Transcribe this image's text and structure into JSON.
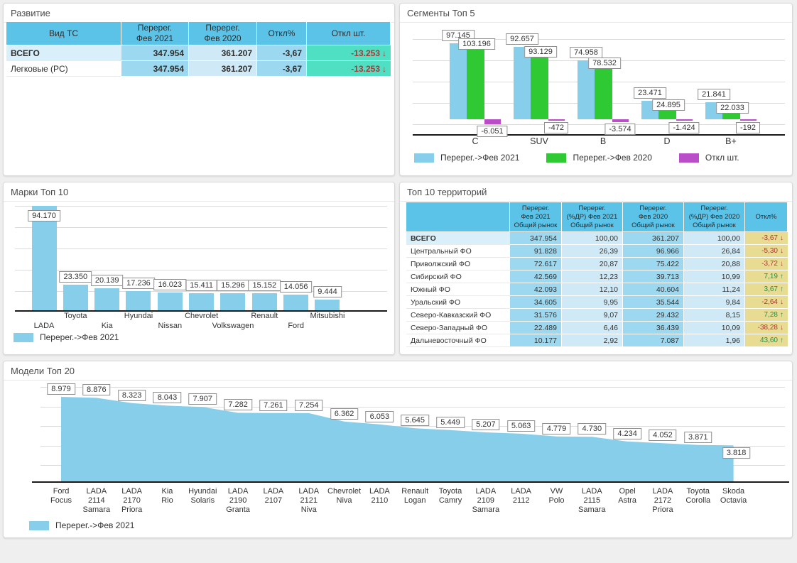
{
  "colors": {
    "background": "#EFEFEF",
    "series_blue": "#87CEEA",
    "series_green": "#2EC933",
    "series_purple": "#BA4EC9",
    "header_cyan": "#5CC3E8",
    "cell_medium_blue": "#9CD8EF",
    "cell_light_blue": "#CFEAF6",
    "cell_teal": "#4FE0C4",
    "cell_yellow": "#E8DC92",
    "row_highlight_blue": "#D9EFF9",
    "negative_text": "#B03535",
    "positive_text": "#1F8F4C"
  },
  "panels": {
    "razvitie": {
      "title": "Развитие",
      "table": {
        "headers": [
          "Вид ТС",
          "Перерег.\nФев 2021",
          "Перерег.\nФев 2020",
          "Откл%",
          "Откл шт."
        ],
        "rows": [
          {
            "label": "ВСЕГО",
            "bold": true,
            "feb2021": "347.954",
            "feb2020": "361.207",
            "otkl_pct": "-3,67",
            "otkl_sht": "-13.253",
            "trend": "down"
          },
          {
            "label": "Легковые (PC)",
            "bold": false,
            "feb2021": "347.954",
            "feb2020": "361.207",
            "otkl_pct": "-3,67",
            "otkl_sht": "-13.253",
            "trend": "down"
          }
        ]
      }
    },
    "segmenty": {
      "title": "Сегменты Топ 5"
    },
    "marki": {
      "title": "Марки Топ 10"
    },
    "territorii": {
      "title": "Топ 10 территорий",
      "table": {
        "headers": [
          "",
          "Перерег.\nФев 2021\nОбщий рынок",
          "Перерег.\n(%ДР) Фев 2021\nОбщий рынок",
          "Перерег.\nФев 2020\nОбщий рынок",
          "Перерег.\n(%ДР) Фев 2020\nОбщий рынок",
          "Откл%"
        ],
        "rows": [
          {
            "label": "ВСЕГО",
            "bold": true,
            "values": [
              "347.954",
              "100,00",
              "361.207",
              "100,00"
            ],
            "otkl": "-3,67",
            "trend": "down"
          },
          {
            "label": "Центральный ФО",
            "bold": false,
            "values": [
              "91.828",
              "26,39",
              "96.966",
              "26,84"
            ],
            "otkl": "-5,30",
            "trend": "down"
          },
          {
            "label": "Приволжский ФО",
            "bold": false,
            "values": [
              "72.617",
              "20,87",
              "75.422",
              "20,88"
            ],
            "otkl": "-3,72",
            "trend": "down"
          },
          {
            "label": "Сибирский ФО",
            "bold": false,
            "values": [
              "42.569",
              "12,23",
              "39.713",
              "10,99"
            ],
            "otkl": "7,19",
            "trend": "up"
          },
          {
            "label": "Южный ФО",
            "bold": false,
            "values": [
              "42.093",
              "12,10",
              "40.604",
              "11,24"
            ],
            "otkl": "3,67",
            "trend": "up"
          },
          {
            "label": "Уральский ФО",
            "bold": false,
            "values": [
              "34.605",
              "9,95",
              "35.544",
              "9,84"
            ],
            "otkl": "-2,64",
            "trend": "down"
          },
          {
            "label": "Северо-Кавказский ФО",
            "bold": false,
            "values": [
              "31.576",
              "9,07",
              "29.432",
              "8,15"
            ],
            "otkl": "7,28",
            "trend": "up"
          },
          {
            "label": "Северо-Западный ФО",
            "bold": false,
            "values": [
              "22.489",
              "6,46",
              "36.439",
              "10,09"
            ],
            "otkl": "-38,28",
            "trend": "down"
          },
          {
            "label": "Дальневосточный ФО",
            "bold": false,
            "values": [
              "10.177",
              "2,92",
              "7.087",
              "1,96"
            ],
            "otkl": "43,60",
            "trend": "up"
          }
        ]
      }
    },
    "modeli": {
      "title": "Модели Топ 20"
    }
  },
  "chart_data": [
    {
      "type": "bar",
      "title": "Сегменты Топ 5",
      "categories": [
        "C",
        "SUV",
        "B",
        "D",
        "B+"
      ],
      "series": [
        {
          "name": "Перерег.->Фев 2021",
          "color": "#87CEEA",
          "values": [
            97145,
            92657,
            74958,
            23471,
            21841
          ]
        },
        {
          "name": "Перерег.->Фев 2020",
          "color": "#2EC933",
          "values": [
            103196,
            93129,
            78532,
            24895,
            22033
          ]
        },
        {
          "name": "Откл шт.",
          "color": "#BA4EC9",
          "values": [
            -6051,
            -472,
            -3574,
            -1424,
            -192
          ]
        }
      ],
      "grid": true,
      "legend_position": "bottom"
    },
    {
      "type": "bar",
      "title": "Марки Топ 10",
      "categories": [
        "LADA",
        "Toyota",
        "Kia",
        "Hyundai",
        "Nissan",
        "Chevrolet",
        "Volkswagen",
        "Renault",
        "Ford",
        "Mitsubishi"
      ],
      "series": [
        {
          "name": "Перерег.->Фев 2021",
          "color": "#87CEEA",
          "values": [
            94170,
            23350,
            20139,
            17236,
            16023,
            15411,
            15296,
            15152,
            14056,
            9444
          ]
        }
      ],
      "grid": true,
      "legend_position": "bottom"
    },
    {
      "type": "area",
      "title": "Модели Топ 20",
      "categories": [
        "Ford Focus",
        "LADA 2114 Samara",
        "LADA 2170 Priora",
        "Kia Rio",
        "Hyundai Solaris",
        "LADA 2190 Granta",
        "LADA 2107",
        "LADA 2121 Niva",
        "Chevrolet Niva",
        "LADA 2110",
        "Renault Logan",
        "Toyota Camry",
        "LADA 2109 Samara",
        "LADA 2112",
        "VW Polo",
        "LADA 2115 Samara",
        "Opel Astra",
        "LADA 2172 Priora",
        "Toyota Corolla",
        "Skoda Octavia"
      ],
      "series": [
        {
          "name": "Перерег.->Фев 2021",
          "color": "#87CEEA",
          "values": [
            8979,
            8876,
            8323,
            8043,
            7907,
            7282,
            7261,
            7254,
            6362,
            6053,
            5645,
            5449,
            5207,
            5063,
            4779,
            4730,
            4234,
            4052,
            3871,
            3818
          ]
        }
      ],
      "grid": true,
      "legend_position": "bottom"
    }
  ]
}
